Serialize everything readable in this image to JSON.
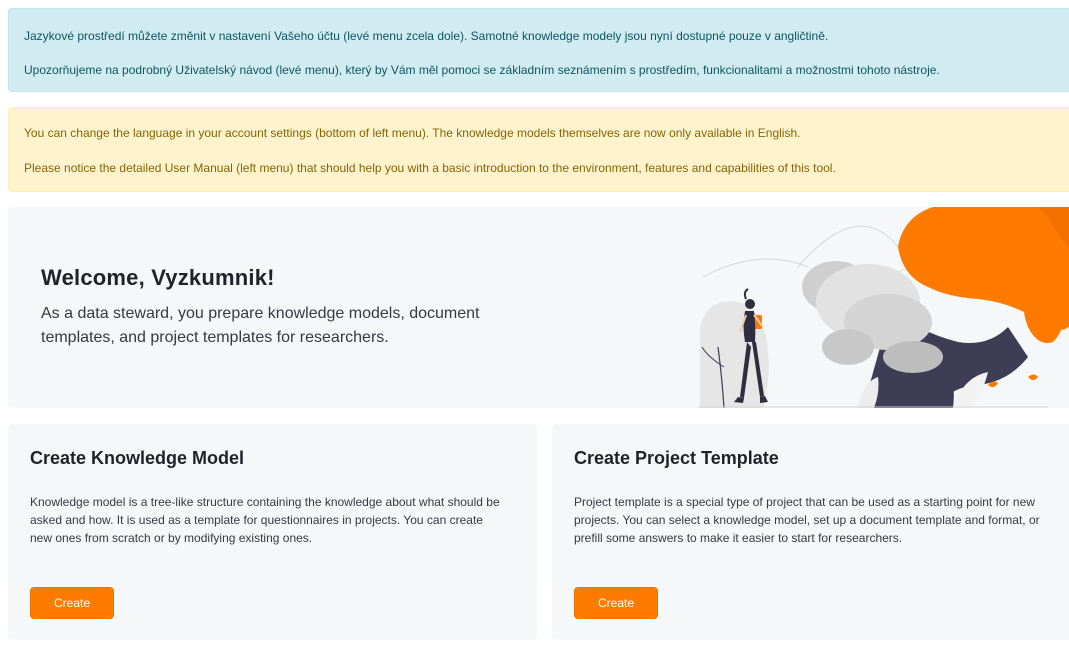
{
  "alerts": {
    "info": {
      "line1": "Jazykové prostředí můžete změnit v nastavení Vašeho účtu (levé menu zcela dole). Samotné knowledge modely jsou nyní dostupné pouze v angličtině.",
      "line2": "Upozorňujeme na podrobný Uživatelský návod (levé menu), který by Vám měl pomoci se základním seznámením s prostředím, funkcionalitami a možnostmi tohoto nástroje."
    },
    "warning": {
      "line1": "You can change the language in your account settings (bottom of left menu). The knowledge models themselves are now only available in English.",
      "line2": "Please notice the detailed User Manual (left menu) that should help you with a basic introduction to the environment, features and capabilities of this tool."
    }
  },
  "welcome": {
    "title": "Welcome, Vyzkumnik!",
    "lead": "As a data steward, you prepare knowledge models, document templates, and project templates for researchers."
  },
  "cards": {
    "knowledge_model": {
      "title": "Create Knowledge Model",
      "description": "Knowledge model is a tree-like structure containing the knowledge about what should be asked and how. It is used as a template for questionnaires in projects. You can create new ones from scratch or by modifying existing ones.",
      "button_label": "Create"
    },
    "project_template": {
      "title": "Create Project Template",
      "description": "Project template is a special type of project that can be used as a starting point for new projects. You can select a knowledge model, set up a document template and format, or prefill some answers to make it easier to start for researchers.",
      "button_label": "Create"
    }
  },
  "colors": {
    "accent": "#ff7b00",
    "info_bg": "#d1ecf1",
    "warning_bg": "#fff3cd",
    "card_bg": "#f6f7f9",
    "illustration_dark": "#3f3d56"
  }
}
